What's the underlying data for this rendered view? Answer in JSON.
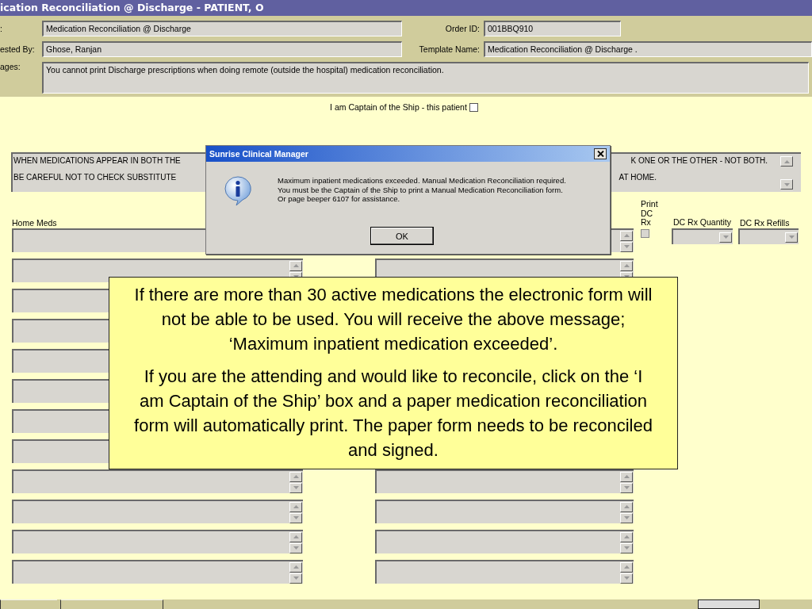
{
  "window": {
    "title": "ication Reconciliation @ Discharge - PATIENT, O"
  },
  "header": {
    "order_name": {
      "label": ":",
      "value": "Medication Reconciliation @ Discharge"
    },
    "order_id": {
      "label": "Order ID:",
      "value": "001BBQ910"
    },
    "requested_by": {
      "label": "ested By:",
      "value": "Ghose, Ranjan"
    },
    "template_name": {
      "label": "Template Name:",
      "value": "Medication Reconciliation @ Discharge ."
    },
    "messages": {
      "label": "ages:",
      "value": "You cannot print Discharge prescriptions when doing remote (outside the hospital) medication reconciliation."
    }
  },
  "captain": {
    "label": "I am Captain of the Ship - this patient",
    "checked": false
  },
  "instructions": [
    {
      "left": "WHEN MEDICATIONS APPEAR IN BOTH THE",
      "right": "K ONE OR THE OTHER - NOT BOTH."
    },
    {
      "left": "BE CAREFUL NOT TO CHECK SUBSTITUTE",
      "right": "AT HOME."
    }
  ],
  "columns": {
    "home_meds": "Home Meds",
    "print_dc_rx": "Print DC Rx",
    "dc_rx_quantity": "DC Rx Quantity",
    "dc_rx_refills": "DC Rx Refills"
  },
  "print_dc_rx": {
    "checked": false
  },
  "dialog": {
    "title": "Sunrise Clinical Manager",
    "message": "Maximum inpatient medications exceeded.  Manual Medication Reconciliation required. You must be the Captain of the Ship to print a Manual Medication Reconciliation form.  Or page beeper 6107 for assistance.",
    "button": "OK"
  },
  "callout": {
    "paragraphs": [
      "If there are more than 30 active medications the electronic form will not be able to be used. You will receive the above message; ‘Maximum inpatient medication exceeded’.",
      "If you are the attending and would like to reconcile, click on the ‘I am Captain of the Ship’ box and a paper medication reconciliation form will automatically print.  The paper form needs to be reconciled and signed."
    ]
  }
}
